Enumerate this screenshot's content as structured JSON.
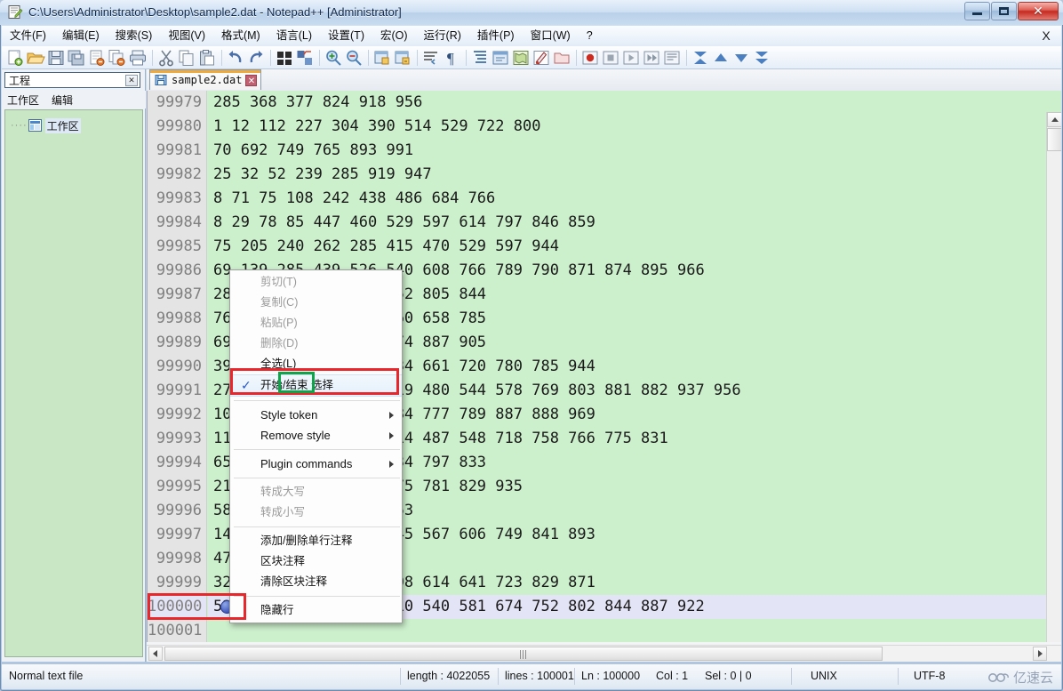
{
  "window": {
    "title": "C:\\Users\\Administrator\\Desktop\\sample2.dat - Notepad++ [Administrator]",
    "icon": "notepadpp-icon",
    "minimize_label": "",
    "restore_label": "",
    "close_label": "✕"
  },
  "menubar": {
    "items": [
      {
        "label": "文件(F)",
        "name": "menu-file"
      },
      {
        "label": "编辑(E)",
        "name": "menu-edit"
      },
      {
        "label": "搜索(S)",
        "name": "menu-search"
      },
      {
        "label": "视图(V)",
        "name": "menu-view"
      },
      {
        "label": "格式(M)",
        "name": "menu-format"
      },
      {
        "label": "语言(L)",
        "name": "menu-language"
      },
      {
        "label": "设置(T)",
        "name": "menu-settings"
      },
      {
        "label": "宏(O)",
        "name": "menu-macro"
      },
      {
        "label": "运行(R)",
        "name": "menu-run"
      },
      {
        "label": "插件(P)",
        "name": "menu-plugins"
      },
      {
        "label": "窗口(W)",
        "name": "menu-window"
      },
      {
        "label": "?",
        "name": "menu-help"
      }
    ],
    "close_document_label": "X"
  },
  "toolbar": {
    "groups": [
      [
        "new-file-icon",
        "open-file-icon",
        "save-icon",
        "save-all-icon",
        "close-file-icon",
        "close-all-icon",
        "print-icon"
      ],
      [
        "cut-icon",
        "copy-icon",
        "paste-icon"
      ],
      [
        "undo-icon",
        "redo-icon"
      ],
      [
        "find-icon",
        "replace-icon"
      ],
      [
        "zoom-in-icon",
        "zoom-out-icon"
      ],
      [
        "sync-vertical-scroll-icon",
        "sync-horizontal-scroll-icon"
      ],
      [
        "word-wrap-icon",
        "show-all-chars-icon"
      ],
      [
        "indent-guide-icon",
        "user-defined-dialog-icon",
        "doc-map-icon",
        "function-list-icon",
        "folder-as-workspace-icon"
      ],
      [
        "record-macro-icon",
        "stop-record-icon",
        "play-macro-icon",
        "run-macro-multiple-icon",
        "save-macro-icon"
      ],
      [
        "fold-all-icon",
        "collapse-level-icon",
        "expand-level-icon",
        "unfold-all-icon"
      ]
    ]
  },
  "project_panel": {
    "title": "工程",
    "close_label": "✕",
    "menu": [
      "工作区",
      "编辑"
    ],
    "tree": [
      {
        "label": "工作区",
        "icon": "workspace-icon"
      }
    ]
  },
  "tabs": [
    {
      "label": "sample2.dat",
      "icon": "saved-file-icon",
      "close_label": "✕",
      "active": true
    }
  ],
  "editor": {
    "current_line_number": "100000",
    "lines": [
      {
        "no": "99979",
        "text": "285 368 377 824 918 956"
      },
      {
        "no": "99980",
        "text": "1 12 112 227 304 390 514 529 722 800"
      },
      {
        "no": "99981",
        "text": "70 692 749 765 893 991"
      },
      {
        "no": "99982",
        "text": "25 32 52 239 285 919 947"
      },
      {
        "no": "99983",
        "text": "8 71 75 108 242 438 486 684 766"
      },
      {
        "no": "99984",
        "text": "8 29 78 85 447 460 529 597 614 797 846 859"
      },
      {
        "no": "99985",
        "text": "75 205 240 262 285 415 470 529 597 944"
      },
      {
        "no": "99986",
        "text": "69 139 285 439 526 540 608 766 789 790 871 874 895 966"
      },
      {
        "no": "99987",
        "text": "28 138 362 395 472 652 805 844"
      },
      {
        "no": "99988",
        "text": "76 155 287 392 429 460 658 785"
      },
      {
        "no": "99989",
        "text": "69 190 337 598 653 774 887 905"
      },
      {
        "no": "99990",
        "text": "39 158 347 450 464 634 661 720 780 785 944"
      },
      {
        "no": "99991",
        "text": "27 166 283 339 349 419 480 544 578 769 803 881 882 937 956"
      },
      {
        "no": "99992",
        "text": "10 129 290 478 574 684 777 789 887 888 969"
      },
      {
        "no": "99993",
        "text": "11 134 256 295 308 314 487 548 718 758 766 775 831"
      },
      {
        "no": "99994",
        "text": "65 172 264 351 401 634 797 833"
      },
      {
        "no": "99995",
        "text": "21 183 250 369 414 775 781 829 935"
      },
      {
        "no": "99996",
        "text": "58 161 372 795 825 853"
      },
      {
        "no": "99997",
        "text": "14 120 271 351 354 545 567 606 749 841 893"
      },
      {
        "no": "99998",
        "text": "47 178 310 438 629"
      },
      {
        "no": "99999",
        "text": "32 149 262 285 494 598 614 641 723 829 871"
      },
      {
        "no": "100000",
        "text": "52 239 372 419 448 510 540 581 674 752 802 844 887 922",
        "current": true
      },
      {
        "no": "100001",
        "text": ""
      }
    ]
  },
  "context_menu": {
    "items": [
      {
        "label": "剪切(T)",
        "name": "ctx-cut",
        "state": "disabled"
      },
      {
        "label": "复制(C)",
        "name": "ctx-copy",
        "state": "disabled"
      },
      {
        "label": "粘贴(P)",
        "name": "ctx-paste",
        "state": "disabled"
      },
      {
        "label": "删除(D)",
        "name": "ctx-delete",
        "state": "disabled"
      },
      {
        "label": "全选(L)",
        "name": "ctx-select-all",
        "state": "normal"
      },
      {
        "label": "开始/结束 选择",
        "name": "ctx-begin-end-select",
        "state": "selected",
        "checked": true,
        "check_glyph": "✓"
      },
      {
        "separator": true
      },
      {
        "label": "Style token",
        "name": "ctx-style-token",
        "state": "normal",
        "submenu": true
      },
      {
        "label": "Remove style",
        "name": "ctx-remove-style",
        "state": "normal",
        "submenu": true
      },
      {
        "separator": true
      },
      {
        "label": "Plugin commands",
        "name": "ctx-plugin-commands",
        "state": "normal",
        "submenu": true
      },
      {
        "separator": true
      },
      {
        "label": "转成大写",
        "name": "ctx-upper-case",
        "state": "disabled"
      },
      {
        "label": "转成小写",
        "name": "ctx-lower-case",
        "state": "disabled"
      },
      {
        "separator": true
      },
      {
        "label": "添加/删除单行注释",
        "name": "ctx-toggle-line-comment",
        "state": "normal"
      },
      {
        "label": "区块注释",
        "name": "ctx-block-comment",
        "state": "normal"
      },
      {
        "label": "清除区块注释",
        "name": "ctx-remove-block-comment",
        "state": "normal"
      },
      {
        "separator": true
      },
      {
        "label": "隐藏行",
        "name": "ctx-hide-lines",
        "state": "normal"
      }
    ]
  },
  "annotations": {
    "red_boxes": [
      "ctx-begin-end-select",
      "line-number-100000"
    ],
    "green_boxes": [
      "word-end-in-menu-item"
    ]
  },
  "statusbar": {
    "doc_type": "Normal text file",
    "length_label": "length : 4022055",
    "lines_label": "lines : 100001",
    "ln_label": "Ln : 100000",
    "col_label": "Col : 1",
    "sel_label": "Sel : 0 | 0",
    "eol": "UNIX",
    "encoding": "UTF-8",
    "watermark": "亿速云"
  },
  "colors": {
    "editor_background": "#ccefcc",
    "current_line": "#e4e4f7",
    "gutter": "#e4e4e4",
    "annotation_red": "#e8272d",
    "annotation_green": "#0fa44a",
    "tab_active_stripe": "#f0a93b"
  }
}
